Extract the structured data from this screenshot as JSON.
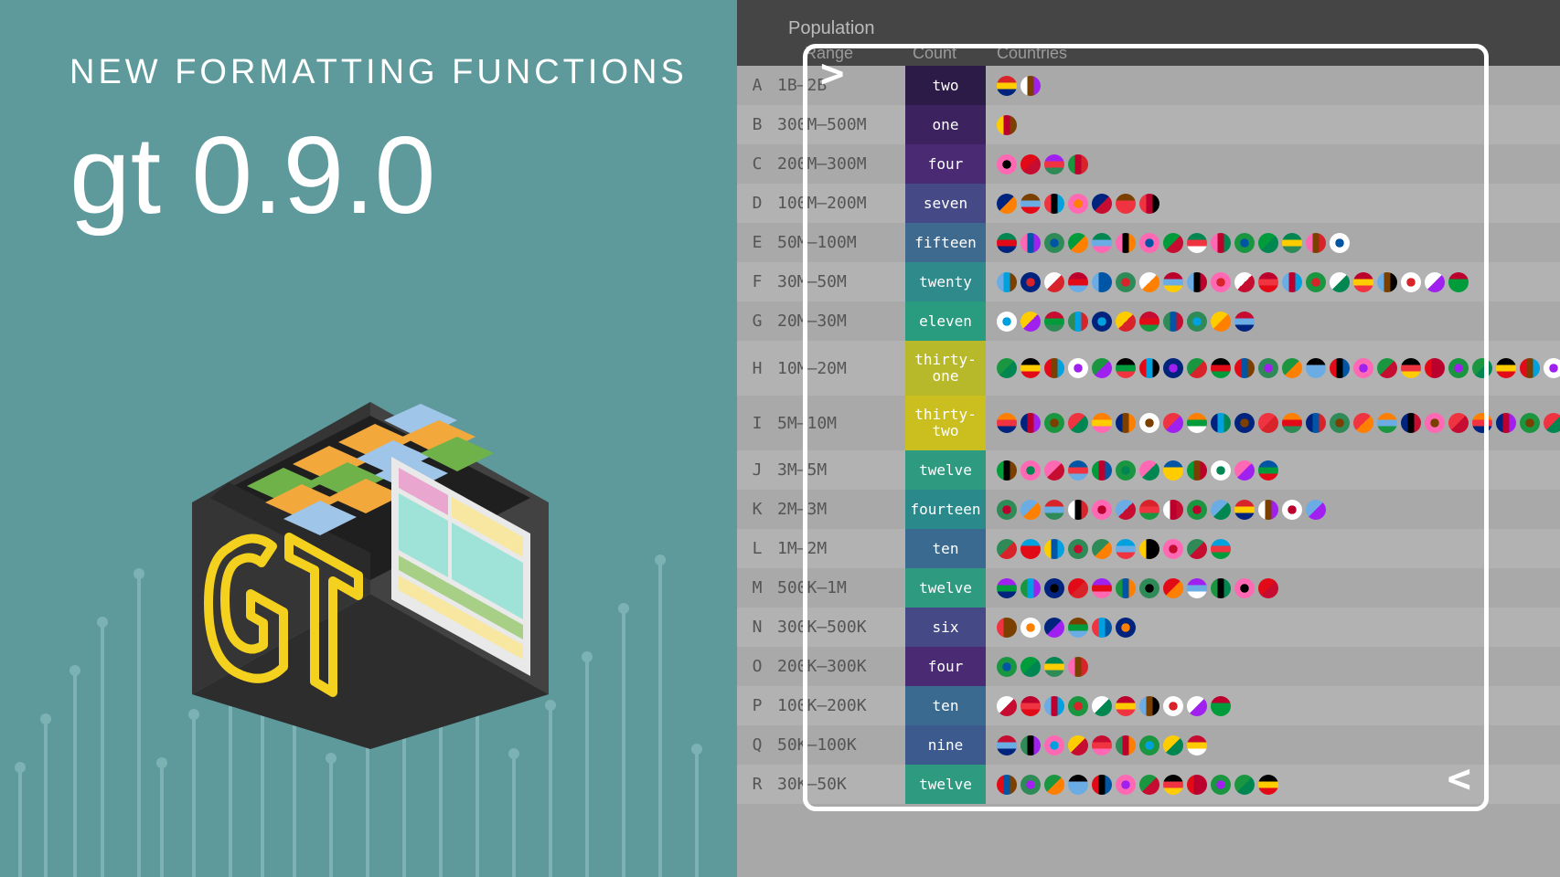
{
  "left": {
    "subtitle": "NEW FORMATTING FUNCTIONS",
    "title": "gt 0.9.0"
  },
  "table": {
    "header": {
      "spanner": "Population",
      "col_range": "Range",
      "col_count": "Count",
      "col_countries": "Countries"
    },
    "rows": [
      {
        "idx": "A",
        "range": "1B–2B",
        "count": "two",
        "n": 2,
        "bg": "#2c1a47"
      },
      {
        "idx": "B",
        "range": "300M–500M",
        "count": "one",
        "n": 1,
        "bg": "#3d2260"
      },
      {
        "idx": "C",
        "range": "200M–300M",
        "count": "four",
        "n": 4,
        "bg": "#4a2a72"
      },
      {
        "idx": "D",
        "range": "100M–200M",
        "count": "seven",
        "n": 7,
        "bg": "#454a87"
      },
      {
        "idx": "E",
        "range": "50M–100M",
        "count": "fifteen",
        "n": 15,
        "bg": "#3e6a8f"
      },
      {
        "idx": "F",
        "range": "30M–50M",
        "count": "twenty",
        "n": 20,
        "bg": "#2f8a8c"
      },
      {
        "idx": "G",
        "range": "20M–30M",
        "count": "eleven",
        "n": 11,
        "bg": "#299b7e"
      },
      {
        "idx": "H",
        "range": "10M–20M",
        "count": "thirty-one",
        "n": 31,
        "bg": "#b7b82a",
        "tall": true
      },
      {
        "idx": "I",
        "range": "5M–10M",
        "count": "thirty-two",
        "n": 32,
        "bg": "#cabf1e",
        "tall": true
      },
      {
        "idx": "J",
        "range": "3M–5M",
        "count": "twelve",
        "n": 12,
        "bg": "#2e9a80"
      },
      {
        "idx": "K",
        "range": "2M–3M",
        "count": "fourteen",
        "n": 14,
        "bg": "#2a8a8b"
      },
      {
        "idx": "L",
        "range": "1M–2M",
        "count": "ten",
        "n": 10,
        "bg": "#3a6a8f"
      },
      {
        "idx": "M",
        "range": "500K–1M",
        "count": "twelve",
        "n": 12,
        "bg": "#2e9a80"
      },
      {
        "idx": "N",
        "range": "300K–500K",
        "count": "six",
        "n": 6,
        "bg": "#454a87"
      },
      {
        "idx": "O",
        "range": "200K–300K",
        "count": "four",
        "n": 4,
        "bg": "#4a2a72"
      },
      {
        "idx": "P",
        "range": "100K–200K",
        "count": "ten",
        "n": 10,
        "bg": "#3a6a8f"
      },
      {
        "idx": "Q",
        "range": "50K–100K",
        "count": "nine",
        "n": 9,
        "bg": "#3d5a8f"
      },
      {
        "idx": "R",
        "range": "30K–50K",
        "count": "twelve",
        "n": 12,
        "bg": "#2e9a80"
      }
    ]
  },
  "frame": {
    "gt": ">",
    "lt": "<"
  },
  "flag_palette": [
    "#d8232a",
    "#1a9641",
    "#0055a4",
    "#ffcc00",
    "#ff7f00",
    "#ffffff",
    "#000000",
    "#009c3b",
    "#c60c30",
    "#00247d",
    "#bc002d",
    "#e30a17",
    "#008751",
    "#2e8b57",
    "#7b3f00",
    "#6cace4",
    "#a020f0",
    "#ff69b4",
    "#00a1de",
    "#ef3340"
  ]
}
